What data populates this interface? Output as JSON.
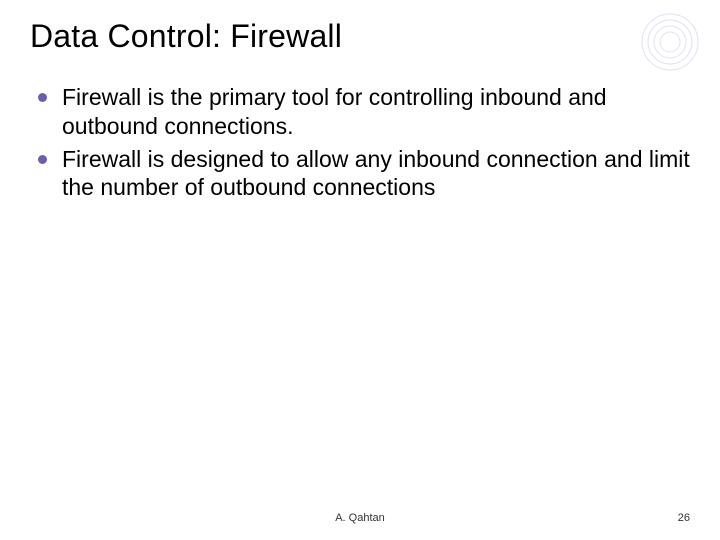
{
  "title": "Data Control: Firewall",
  "bullets": [
    "Firewall is the primary tool for controlling inbound and outbound connections.",
    "Firewall is designed to allow any inbound connection and limit the number of outbound connections"
  ],
  "footer": {
    "author": "A. Qahtan",
    "page": "26"
  },
  "style": {
    "bullet_color": "#6b5fa8",
    "deco_stroke": "#d8d2ec"
  }
}
